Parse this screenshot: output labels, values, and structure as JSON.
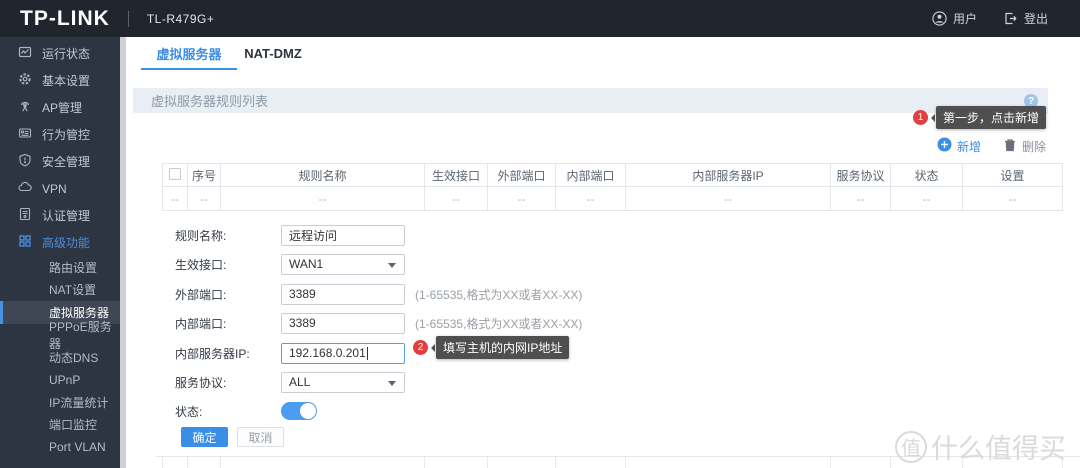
{
  "header": {
    "brand": "TP-LINK",
    "model": "TL-R479G+",
    "user_label": "用户",
    "logout_label": "登出"
  },
  "sidebar": {
    "items": [
      {
        "label": "运行状态",
        "icon": "status-monitor-icon"
      },
      {
        "label": "基本设置",
        "icon": "gear-icon"
      },
      {
        "label": "AP管理",
        "icon": "antenna-icon"
      },
      {
        "label": "行为管控",
        "icon": "behavior-icon"
      },
      {
        "label": "安全管理",
        "icon": "shield-icon"
      },
      {
        "label": "VPN",
        "icon": "cloud-icon"
      },
      {
        "label": "认证管理",
        "icon": "id-card-icon"
      },
      {
        "label": "高级功能",
        "icon": "grid-icon"
      }
    ],
    "subitems": [
      {
        "label": "路由设置"
      },
      {
        "label": "NAT设置"
      },
      {
        "label": "虚拟服务器",
        "active": true
      },
      {
        "label": "PPPoE服务器"
      },
      {
        "label": "动态DNS"
      },
      {
        "label": "UPnP"
      },
      {
        "label": "IP流量统计"
      },
      {
        "label": "端口监控"
      },
      {
        "label": "Port VLAN"
      }
    ]
  },
  "tabs": [
    {
      "label": "虚拟服务器",
      "active": true
    },
    {
      "label": "NAT-DMZ",
      "active": false
    }
  ],
  "panel": {
    "title": "虚拟服务器规则列表",
    "help": "?"
  },
  "callouts": {
    "step1": {
      "num": "1",
      "text": "第一步，点击新增"
    },
    "step2": {
      "num": "2",
      "text": "填写主机的内网IP地址"
    }
  },
  "toolbar": {
    "add_label": "新增",
    "delete_label": "删除"
  },
  "table": {
    "headers": [
      "序号",
      "规则名称",
      "生效接口",
      "外部端口",
      "内部端口",
      "内部服务器IP",
      "服务协议",
      "状态",
      "设置"
    ],
    "empty": "--"
  },
  "form": {
    "rule_name": {
      "label": "规则名称:",
      "value": "远程访问"
    },
    "interface": {
      "label": "生效接口:",
      "value": "WAN1"
    },
    "external_port": {
      "label": "外部端口:",
      "value": "3389",
      "hint": "(1-65535,格式为XX或者XX-XX)"
    },
    "internal_port": {
      "label": "内部端口:",
      "value": "3389",
      "hint": "(1-65535,格式为XX或者XX-XX)"
    },
    "server_ip": {
      "label": "内部服务器IP:",
      "value": "192.168.0.201"
    },
    "protocol": {
      "label": "服务协议:",
      "value": "ALL"
    },
    "status": {
      "label": "状态:",
      "on": true
    }
  },
  "buttons": {
    "ok": "确定",
    "cancel": "取消"
  },
  "watermark": {
    "badge": "值",
    "text": "什么值得买"
  }
}
